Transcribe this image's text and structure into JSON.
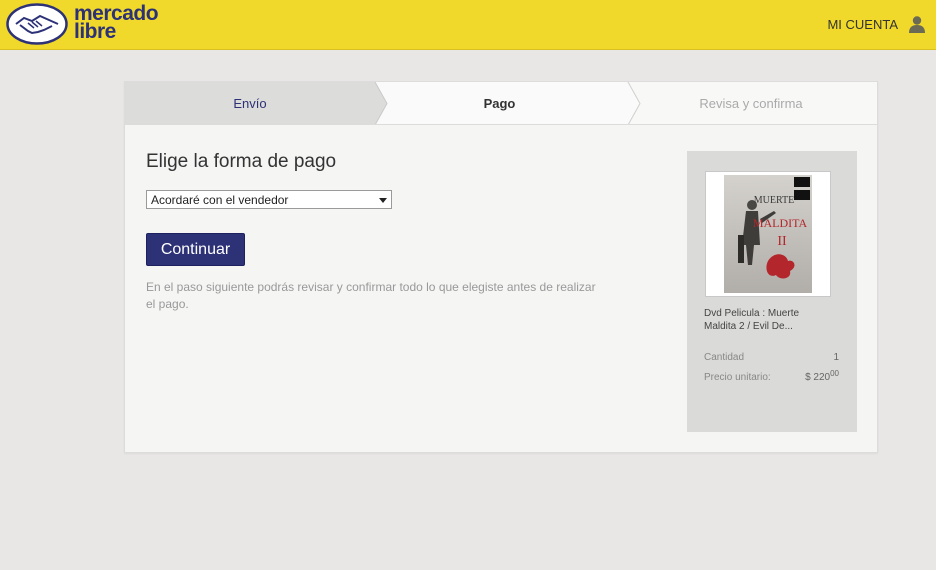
{
  "brand": {
    "line1": "mercado",
    "line2": "libre"
  },
  "header": {
    "account_label": "MI CUENTA"
  },
  "steps": [
    {
      "label": "Envío"
    },
    {
      "label": "Pago"
    },
    {
      "label": "Revisa y confirma"
    }
  ],
  "payment": {
    "title": "Elige la forma de pago",
    "selected_method": "Acordaré con el vendedor",
    "continue_label": "Continuar",
    "info": "En el paso siguiente podrás revisar y confirmar todo lo que elegiste antes de realizar el pago."
  },
  "product": {
    "name": "Dvd Pelicula : Muerte Maldita 2 / Evil De...",
    "quantity_label": "Cantidad",
    "quantity": "1",
    "price_label": "Precio unitario:",
    "price_main": "$ 220",
    "price_cents": "00",
    "cover_text": [
      "MUERTE",
      "MALDITA",
      "II"
    ]
  },
  "colors": {
    "header_bg": "#f0d92a",
    "brand_blue": "#2d3277",
    "page_bg": "#e8e7e6"
  }
}
